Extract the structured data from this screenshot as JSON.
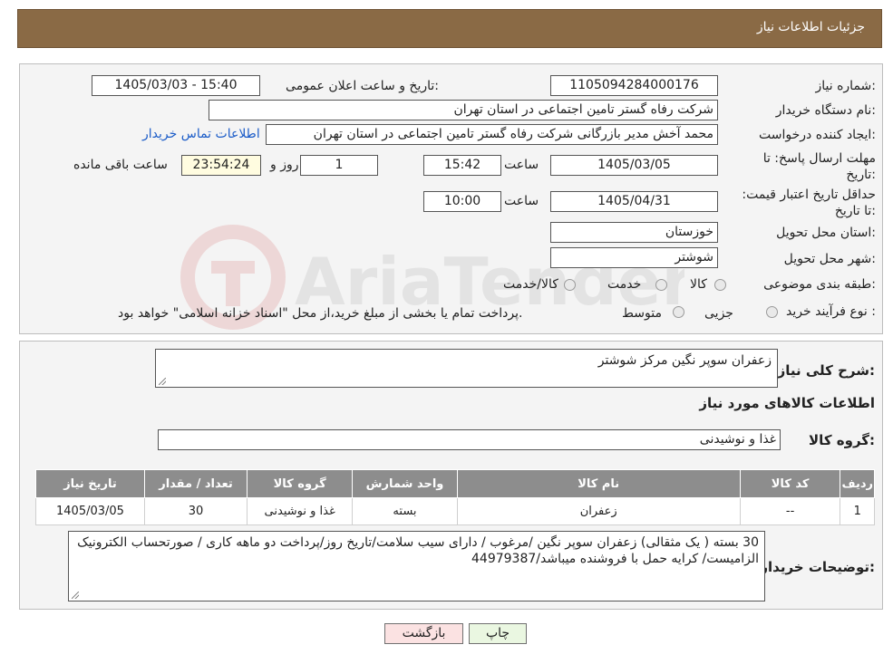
{
  "header": {
    "title": "جزئیات اطلاعات نیاز"
  },
  "watermark": {
    "text": "AriaTender.neT"
  },
  "form": {
    "need_number_label": "شماره نیاز:",
    "need_number": "1105094284000176",
    "announce_label": "تاریخ و ساعت اعلان عمومی:",
    "announce_value": "1405/03/03 - 15:40",
    "buyer_org_label": "نام دستگاه خریدار:",
    "buyer_org": "شرکت رفاه گستر تامین اجتماعی در استان تهران",
    "creator_label": "ایجاد کننده درخواست:",
    "creator": "محمد آخش مدیر بازرگانی شرکت رفاه گستر تامین اجتماعی در استان تهران",
    "contact_link": "اطلاعات تماس خریدار",
    "deadline_label": "مهلت ارسال پاسخ: تا تاریخ:",
    "deadline_date": "1405/03/05",
    "time_label": "ساعت",
    "deadline_time": "15:42",
    "days_value": "1",
    "days_label": "روز و",
    "remaining_time": "23:54:24",
    "remaining_label": "ساعت باقی مانده",
    "validity_label": "حداقل تاریخ اعتبار قیمت: تا تاریخ:",
    "validity_date": "1405/04/31",
    "validity_time": "10:00",
    "province_label": "استان محل تحویل:",
    "province": "خوزستان",
    "city_label": "شهر محل تحویل:",
    "city": "شوشتر",
    "category_label": "طبقه بندی موضوعی:",
    "category_options": [
      "کالا",
      "خدمت",
      "کالا/خدمت"
    ],
    "process_label": "نوع فرآیند خرید :",
    "process_options": [
      "جزیی",
      "متوسط"
    ],
    "process_note": "پرداخت تمام یا بخشی از مبلغ خرید،از محل \"اسناد خزانه اسلامی\" خواهد بود."
  },
  "details": {
    "summary_label": "شرح کلی نیاز:",
    "summary": "زعفران سوپر نگین مرکز شوشتر",
    "goods_title": "اطلاعات کالاهای مورد نیاز",
    "group_label": "گروه کالا:",
    "group": "غذا و نوشیدنی",
    "table": {
      "headers": [
        "ردیف",
        "کد کالا",
        "نام کالا",
        "واحد شمارش",
        "گروه کالا",
        "تعداد / مقدار",
        "تاریخ نیاز"
      ],
      "rows": [
        [
          "1",
          "--",
          "زعفران",
          "بسته",
          "غذا و نوشیدنی",
          "30",
          "1405/03/05"
        ]
      ]
    },
    "buyer_notes_label": "توضیحات خریدار:",
    "buyer_notes": "30 بسته ( یک مثقالی) زعفران سوپر نگین /مرغوب / دارای سیب سلامت/تاریخ روز/پرداخت دو ماهه کاری / صورتحساب الکترونیک الزامیست/ کرایه حمل با فروشنده میباشد/44979387"
  },
  "buttons": {
    "print": "چاپ",
    "back": "بازگشت"
  },
  "colors": {
    "header_bg": "#8a6a45",
    "link": "#1b5cc8",
    "back_button": "#fbe2e2",
    "print_button": "#eaf7e1"
  }
}
